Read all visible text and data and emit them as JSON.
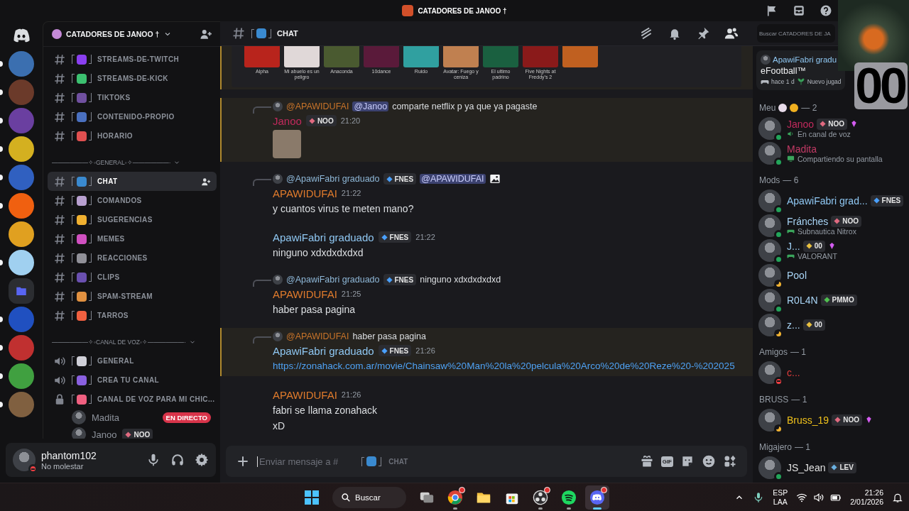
{
  "title_bar": {
    "server_name": "CATADORES DE JANOO †"
  },
  "servers": [
    {
      "kind": "home"
    },
    {
      "kind": "server",
      "color": "#3b6fb0",
      "unread": true
    },
    {
      "kind": "server",
      "color": "#6b3a2a",
      "unread": true
    },
    {
      "kind": "server",
      "color": "#6a3fa0",
      "unread": true
    },
    {
      "kind": "server",
      "color": "#d4b020",
      "unread": true
    },
    {
      "kind": "server",
      "color": "#3060c0",
      "unread": true
    },
    {
      "kind": "server",
      "color": "#f06010",
      "unread": true
    },
    {
      "kind": "server",
      "color": "#e0a020",
      "unread": false
    },
    {
      "kind": "server",
      "color": "#a0d0f0",
      "unread": true
    },
    {
      "kind": "folder",
      "color": "#5865f2",
      "unread": false
    },
    {
      "kind": "server",
      "color": "#2050c0",
      "unread": true
    },
    {
      "kind": "server",
      "color": "#c03030",
      "unread": true
    },
    {
      "kind": "server",
      "color": "#40a040",
      "unread": true
    },
    {
      "kind": "server",
      "color": "#806040",
      "unread": true
    }
  ],
  "channel_sidebar": {
    "server_name": "CATADORES DE JANOO †",
    "categories": [
      {
        "items": [
          {
            "kind": "text",
            "name": "STREAMS-DE-TWITCH",
            "color": "#8a3ff0",
            "selected": false
          },
          {
            "kind": "text",
            "name": "STREAMS-DE-KICK",
            "color": "#3cc070",
            "selected": false
          },
          {
            "kind": "text",
            "name": "TIKTOKS",
            "color": "#7050a0",
            "selected": false
          },
          {
            "kind": "text",
            "name": "CONTENIDO-PROPIO",
            "color": "#4a70c0",
            "selected": false
          },
          {
            "kind": "text",
            "name": "HORARIO",
            "color": "#e05050",
            "selected": false
          }
        ]
      },
      {
        "label": "——————✧◦GENERAL◦✧——————·",
        "expanded": true,
        "items": [
          {
            "kind": "text",
            "name": "CHAT",
            "color": "#3a8ad0",
            "selected": true
          },
          {
            "kind": "text",
            "name": "COMANDOS",
            "color": "#b8a0d0",
            "selected": false
          },
          {
            "kind": "text",
            "name": "SUGERENCIAS",
            "color": "#f0b030",
            "selected": false
          },
          {
            "kind": "text",
            "name": "MEMES",
            "color": "#d050c0",
            "selected": false
          },
          {
            "kind": "text",
            "name": "REACCIONES",
            "color": "#909098",
            "selected": false
          },
          {
            "kind": "text",
            "name": "CLIPS",
            "color": "#6a50b0",
            "selected": false
          },
          {
            "kind": "text",
            "name": "SPAM-STREAM",
            "color": "#e09040",
            "selected": false
          },
          {
            "kind": "text",
            "name": "TARROS",
            "color": "#f06040",
            "selected": false
          }
        ]
      },
      {
        "label": "——————✧◦CANAL DE VOZ◦✧——————·",
        "expanded": true,
        "items": [
          {
            "kind": "voice",
            "name": "GENERAL",
            "color": "#d0d0d8",
            "selected": false
          },
          {
            "kind": "voice",
            "name": "CREA TU CANAL",
            "color": "#8a60e0",
            "selected": false
          },
          {
            "kind": "locked",
            "name": "CANAL DE VOZ PARA MI CHIC...",
            "color": "#f06080",
            "selected": false,
            "members": [
              {
                "name": "Madita",
                "live": "EN DIRECTO"
              },
              {
                "name": "Janoo",
                "tag": {
                  "label": "NOO",
                  "color": "#e06a80"
                }
              }
            ]
          }
        ]
      }
    ]
  },
  "user_panel": {
    "name": "phantom102",
    "status_text": "No molestar",
    "status": {
      "kind": "dnd"
    }
  },
  "chat": {
    "channel_name": "CHAT",
    "emoji": {
      "color": "#3a8ad0"
    },
    "search": {
      "placeholder": "Buscar CATADORES DE JA"
    },
    "messages": [
      {
        "kind": "embed",
        "highlighted": true,
        "posters": [
          {
            "title": "Alpha",
            "color": "#b8241c"
          },
          {
            "title": "Mi abuelo es un peligro",
            "color": "#e0d8d8"
          },
          {
            "title": "Anaconda",
            "color": "#4a5a30"
          },
          {
            "title": "10dance",
            "color": "#5a1a3a"
          },
          {
            "title": "Ruido",
            "color": "#30a0a0"
          },
          {
            "title": "Avatar: Fuego y ceniza",
            "color": "#c08050"
          },
          {
            "title": "El ultimo padrino",
            "color": "#1a6040"
          },
          {
            "title": "Five Nights at Freddy's 2",
            "color": "#8a1a1a"
          },
          {
            "color": "#c06020"
          }
        ]
      },
      {
        "kind": "message",
        "highlighted": true,
        "reply": {
          "author": "@APAWIDUFAI",
          "color": "#c8742a",
          "mention": "@Janoo",
          "text": "comparte netflix p ya que ya pagaste"
        },
        "author": "Janoo",
        "color": "#c22a5d",
        "tag": {
          "label": "NOO",
          "color": "#e06a80"
        },
        "time": "21:20",
        "image_attachment": true
      },
      {
        "kind": "message",
        "highlighted": false,
        "reply": {
          "author": "@ApawiFabri graduado",
          "color": "#8fb8d8",
          "tag": {
            "label": "FNES",
            "color": "#4aa0ff"
          },
          "mention": "@APAWIDUFAI",
          "image_icon": true
        },
        "author": "APAWIDUFAI",
        "color": "#e07b2c",
        "time": "21:22",
        "lines": [
          "y cuantos virus te meten mano?"
        ]
      },
      {
        "kind": "message",
        "highlighted": false,
        "author": "ApawiFabri graduado",
        "color": "#8fc7f2",
        "tag": {
          "label": "FNES",
          "color": "#4aa0ff"
        },
        "time": "21:22",
        "lines": [
          "ninguno xdxdxdxdxd"
        ]
      },
      {
        "kind": "message",
        "highlighted": false,
        "reply": {
          "author": "@ApawiFabri graduado",
          "color": "#8fb8d8",
          "tag": {
            "label": "FNES",
            "color": "#4aa0ff"
          },
          "text": "ninguno xdxdxdxdxd"
        },
        "author": "APAWIDUFAI",
        "color": "#e07b2c",
        "time": "21:25",
        "lines": [
          "haber pasa pagina"
        ]
      },
      {
        "kind": "message",
        "highlighted": true,
        "reply": {
          "author": "@APAWIDUFAI",
          "color": "#c8742a",
          "text": "haber pasa pagina"
        },
        "author": "ApawiFabri graduado",
        "color": "#8fc7f2",
        "tag": {
          "label": "FNES",
          "color": "#4aa0ff"
        },
        "time": "21:26",
        "link": "https://zonahack.com.ar/movie/Chainsaw%20Man%20la%20pelcula%20Arco%20de%20Reze%20-%202025"
      },
      {
        "kind": "message",
        "highlighted": false,
        "author": "APAWIDUFAI",
        "color": "#e07b2c",
        "time": "21:26",
        "lines": [
          "fabri se llama zonahack",
          "xD"
        ]
      }
    ],
    "composer": {
      "placeholder": "Enviar mensaje a #",
      "emoji": {
        "color": "#3a8ad0"
      },
      "channel_name": "CHAT",
      "gif_label": "GIF"
    }
  },
  "member_list": {
    "activity_card": {
      "user": "ApawiFabri gradu",
      "color": "#8fc7f2",
      "game": "eFootball™",
      "elapsed": "hace 1 d",
      "note": "Nuevo jugad"
    },
    "groups": [
      {
        "label": "Meu",
        "emojis": [
          {
            "color": "#e8dcea"
          },
          {
            "color": "#f0b020"
          }
        ],
        "count": "— 2",
        "members": [
          {
            "name": "Janoo",
            "color": "#c22a5d",
            "tag": {
              "label": "NOO",
              "color": "#e06a80"
            },
            "boosting": true,
            "status": {
              "kind": "online"
            },
            "activity": {
              "kind": "voice",
              "text": "En canal de voz"
            }
          },
          {
            "name": "Madita",
            "color": "#c23a65",
            "boosting": false,
            "status": {
              "kind": "online"
            },
            "activity": {
              "kind": "screen",
              "text": "Compartiendo su pantalla"
            }
          }
        ]
      },
      {
        "label": "Mods",
        "count": "— 6",
        "members": [
          {
            "name": "ApawiFabri grad...",
            "color": "#8fc7f2",
            "tag": {
              "label": "FNES",
              "color": "#4aa0ff"
            },
            "boosting": false,
            "status": {
              "kind": "online"
            }
          },
          {
            "name": "Fránches",
            "color": "#a8d4f5",
            "tag": {
              "label": "NOO",
              "color": "#e06a80"
            },
            "boosting": false,
            "status": {
              "kind": "online"
            },
            "activity": {
              "kind": "game",
              "text": "Subnautica Nitrox"
            }
          },
          {
            "name": "J...",
            "color": "#9fd0f5",
            "tag": {
              "label": "00",
              "color": "#e8c040"
            },
            "boosting": true,
            "status": {
              "kind": "online"
            },
            "activity": {
              "kind": "game",
              "text": "VALORANT"
            }
          },
          {
            "name": "Pool",
            "color": "#a8d4f5",
            "boosting": false,
            "status": {
              "kind": "idle"
            }
          },
          {
            "name": "R0L4N",
            "color": "#a8d4f5",
            "tag": {
              "label": "PMMO",
              "color": "#50c050"
            },
            "boosting": false,
            "status": {
              "kind": "online"
            }
          },
          {
            "name": "z...",
            "color": "#a8d4f5",
            "tag": {
              "label": "00",
              "color": "#e8c040"
            },
            "boosting": false,
            "status": {
              "kind": "idle"
            }
          }
        ]
      },
      {
        "label": "Amigos",
        "count": "— 1",
        "members": [
          {
            "name": "c...",
            "color": "#e03c3c",
            "boosting": false,
            "status": {
              "kind": "dnd"
            }
          }
        ]
      },
      {
        "label": "BRUSS",
        "count": "— 1",
        "members": [
          {
            "name": "Bruss_19",
            "color": "#f0c21c",
            "tag": {
              "label": "NOO",
              "color": "#e06a80"
            },
            "boosting": true,
            "status": {
              "kind": "idle"
            }
          }
        ]
      },
      {
        "label": "Migajero",
        "count": "— 1",
        "members": [
          {
            "name": "JS_Jean",
            "color": "#e0e0e0",
            "tag": {
              "label": "LEV",
              "color": "#6ab0e0"
            },
            "boosting": false,
            "status": {
              "kind": "online"
            }
          }
        ]
      }
    ]
  },
  "stream_overlay": {
    "counter": "00"
  },
  "taskbar": {
    "search_label": "Buscar",
    "apps": [
      {
        "kind": "taskview",
        "running": false,
        "active": false,
        "notification": false
      },
      {
        "kind": "chrome",
        "running": true,
        "active": false,
        "notification": true
      },
      {
        "kind": "explorer",
        "running": false,
        "active": false,
        "notification": false
      },
      {
        "kind": "store",
        "running": false,
        "active": false,
        "notification": false
      },
      {
        "kind": "obs",
        "running": true,
        "active": false,
        "notification": true
      },
      {
        "kind": "spotify",
        "running": true,
        "active": false,
        "notification": false
      },
      {
        "kind": "discord",
        "running": true,
        "active": true,
        "notification": true
      }
    ],
    "language": "ESP",
    "layout": "LAA",
    "time": "21:26",
    "date": "2/01/2026"
  }
}
